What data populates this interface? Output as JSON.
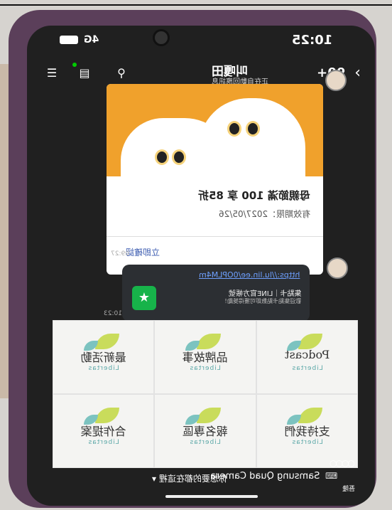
{
  "status_bar": {
    "time": "10:25",
    "network": "4G"
  },
  "header": {
    "count": "99+",
    "title": "叫嘎田",
    "subtitle": "正在自動回應訊息"
  },
  "coupon": {
    "title": "母親節滿 100 享 85折",
    "expiry": "有效期限：2027/05/26",
    "action": "立即確認",
    "time": "09:27"
  },
  "link_card": {
    "url": "https://lu.lin.ee/0OPLM4m",
    "title": "集點卡｜LINE官方帳號",
    "desc": "歡迎集點卡點數即可獲得獎勵！",
    "time": "10:23"
  },
  "menu": {
    "items": [
      {
        "label": "最新活動",
        "sub": "Libertas"
      },
      {
        "label": "品牌故事",
        "sub": "Libertas"
      },
      {
        "label": "Podcast",
        "sub": "Libertas"
      },
      {
        "label": "合作提案",
        "sub": "Libertas"
      },
      {
        "label": "報名專區",
        "sub": "Libertas"
      },
      {
        "label": "支持我們",
        "sub": "Libertas"
      }
    ]
  },
  "bottom_bar": {
    "text": "你想要的都在這裡 ▾"
  },
  "watermark": {
    "text": "Samsung Quad Camera",
    "sub": "吾隆"
  }
}
